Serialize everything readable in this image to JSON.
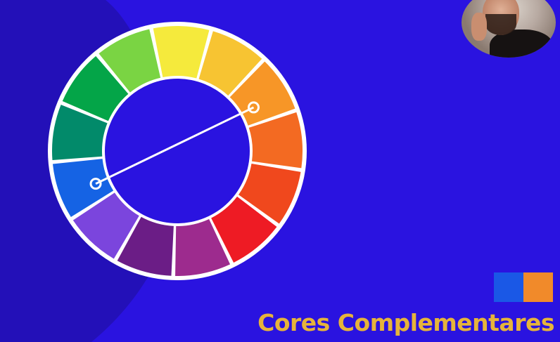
{
  "background_color": "#2a13e0",
  "shadow_color": "#2310b8",
  "caption": {
    "text": "Cores Complementares",
    "color": "#e6b43a"
  },
  "wheel": {
    "segment_colors": [
      "#f5ea3c",
      "#f7c432",
      "#f79627",
      "#f36a22",
      "#f0481d",
      "#ee1b24",
      "#9d2b8e",
      "#6b1d86",
      "#7b45dd",
      "#1563e4",
      "#028a6a",
      "#04a548",
      "#7ad443"
    ],
    "line_color": "#ffffff",
    "connector": {
      "from_segment": "orange",
      "to_segment": "blue"
    }
  },
  "swatches": [
    {
      "name": "blue",
      "color": "#1a58e6"
    },
    {
      "name": "orange",
      "color": "#f18a2a"
    }
  ],
  "webcam": {
    "icon": "presenter-webcam"
  }
}
